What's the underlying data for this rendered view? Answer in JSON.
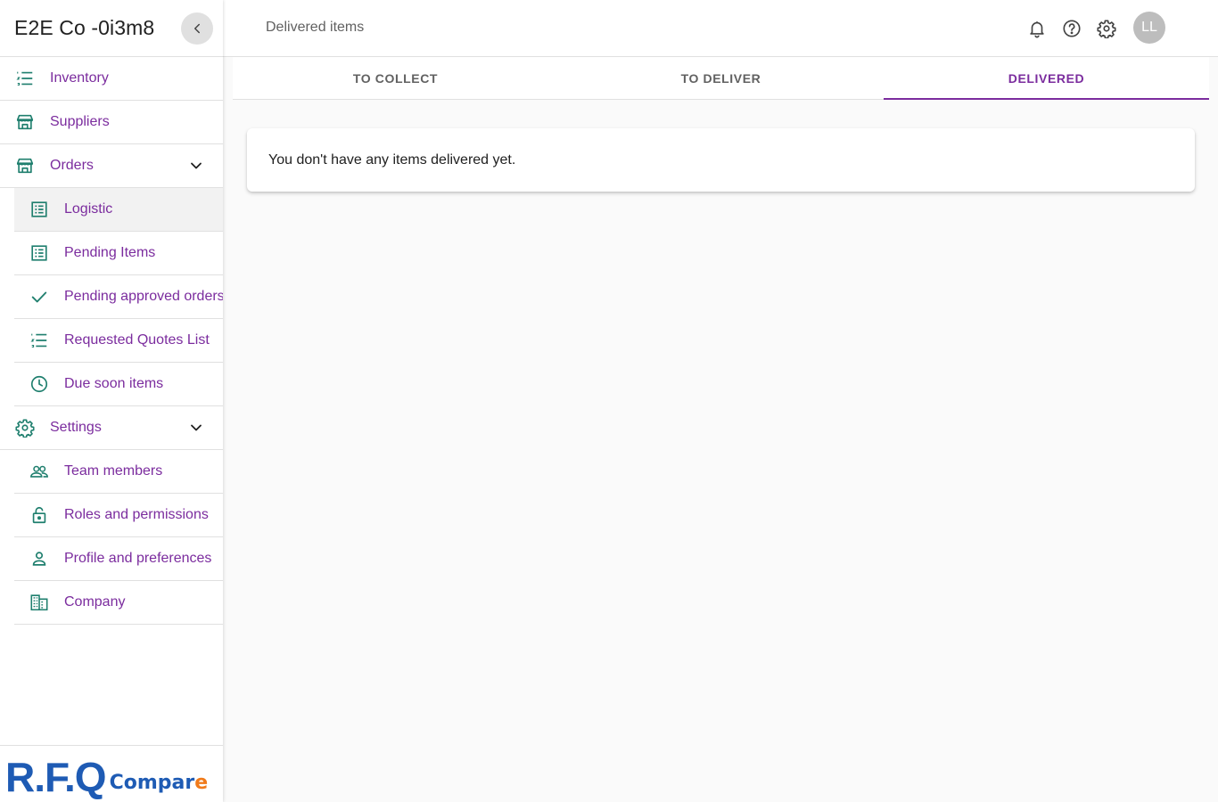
{
  "sidebar": {
    "company_name": "E2E Co -0i3m8",
    "items": [
      {
        "label": "Inventory",
        "icon": "list-icon"
      },
      {
        "label": "Suppliers",
        "icon": "store-icon"
      },
      {
        "label": "Orders",
        "icon": "store-icon"
      },
      {
        "label": "Logistic",
        "icon": "receipt-list-icon"
      },
      {
        "label": "Pending Items",
        "icon": "receipt-list-icon"
      },
      {
        "label": "Pending approved orders",
        "icon": "check-icon"
      },
      {
        "label": "Requested Quotes List",
        "icon": "list-icon"
      },
      {
        "label": "Due soon items",
        "icon": "clock-icon"
      },
      {
        "label": "Settings",
        "icon": "gear-icon"
      },
      {
        "label": "Team members",
        "icon": "people-icon"
      },
      {
        "label": "Roles and permissions",
        "icon": "lock-icon"
      },
      {
        "label": "Profile and preferences",
        "icon": "person-icon"
      },
      {
        "label": "Company",
        "icon": "building-icon"
      }
    ],
    "logo": {
      "main": "R.F.Q",
      "sub_1": "Compar",
      "sub_2": "e"
    }
  },
  "header": {
    "title": "Delivered items",
    "avatar_initials": "LL"
  },
  "tabs": [
    {
      "label": "TO COLLECT",
      "active": false
    },
    {
      "label": "TO DELIVER",
      "active": false
    },
    {
      "label": "DELIVERED",
      "active": true
    }
  ],
  "main": {
    "empty_message": "You don't have any items delivered yet."
  },
  "colors": {
    "accent": "#7b2c9e",
    "icon_teal": "#1f7f6e",
    "logo_blue": "#1e5bb4",
    "logo_orange": "#f07a1a"
  }
}
